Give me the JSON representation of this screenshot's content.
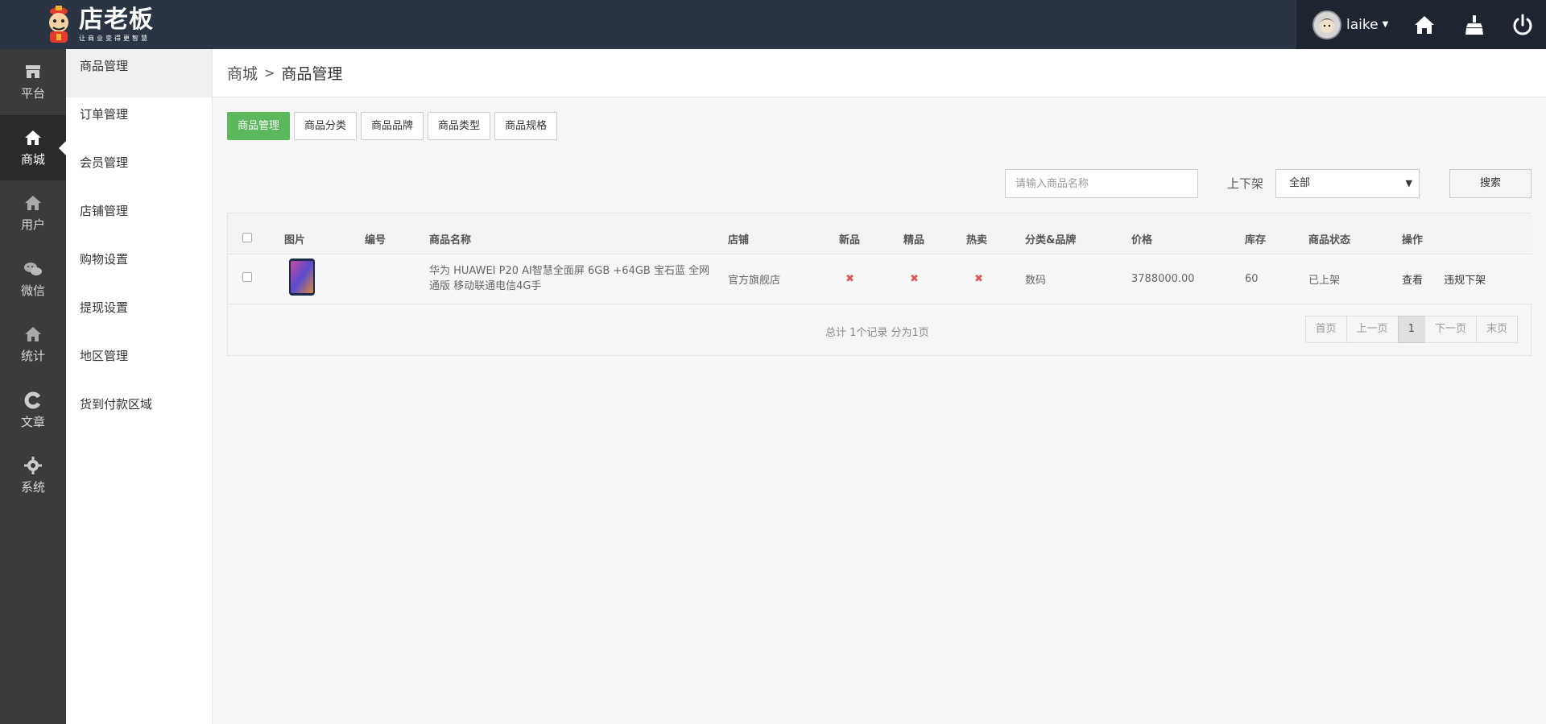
{
  "app": {
    "logo_title": "店老板",
    "logo_subtitle": "让商业变得更智慧"
  },
  "header": {
    "username": "laike",
    "icons": [
      "home-icon",
      "clean-icon",
      "power-icon"
    ]
  },
  "rail": {
    "items": [
      {
        "label": "平台",
        "icon": "store-icon"
      },
      {
        "label": "商城",
        "icon": "home-icon",
        "active": true
      },
      {
        "label": "用户",
        "icon": "user-home-icon"
      },
      {
        "label": "微信",
        "icon": "wechat-icon"
      },
      {
        "label": "统计",
        "icon": "stats-icon"
      },
      {
        "label": "文章",
        "icon": "article-icon"
      },
      {
        "label": "系统",
        "icon": "gear-icon"
      }
    ]
  },
  "submenu": {
    "items": [
      {
        "label": "商品管理",
        "active": true
      },
      {
        "label": "订单管理"
      },
      {
        "label": "会员管理"
      },
      {
        "label": "店铺管理"
      },
      {
        "label": "购物设置"
      },
      {
        "label": "提现设置"
      },
      {
        "label": "地区管理"
      },
      {
        "label": "货到付款区域"
      }
    ]
  },
  "breadcrumb": {
    "root": "商城",
    "sep": ">",
    "current": "商品管理"
  },
  "tabs": [
    "商品管理",
    "商品分类",
    "商品品牌",
    "商品类型",
    "商品规格"
  ],
  "filters": {
    "search_placeholder": "请输入商品名称",
    "status_label": "上下架",
    "status_value": "全部",
    "search_button": "搜索"
  },
  "table": {
    "columns": [
      "图片",
      "编号",
      "商品名称",
      "店铺",
      "新品",
      "精品",
      "热卖",
      "分类&品牌",
      "价格",
      "库存",
      "商品状态",
      "操作"
    ],
    "rows": [
      {
        "id": "",
        "name": "华为 HUAWEI P20 AI智慧全面屏 6GB +64GB 宝石蓝 全网通版 移动联通电信4G手",
        "shop": "官方旗舰店",
        "is_new": "✖",
        "is_fine": "✖",
        "is_hot": "✖",
        "category": "数码",
        "price": "3788000.00",
        "stock": "60",
        "status": "已上架",
        "actions": [
          "查看",
          "违规下架"
        ]
      }
    ]
  },
  "pagination": {
    "total_text": "总计 1个记录 分为1页",
    "first": "首页",
    "prev": "上一页",
    "current": "1",
    "next": "下一页",
    "last": "末页"
  },
  "colors": {
    "topbar": "#2b3442",
    "rail": "#3b3b3b",
    "accent_green": "#5cb85c",
    "flag_red": "#e05555"
  }
}
